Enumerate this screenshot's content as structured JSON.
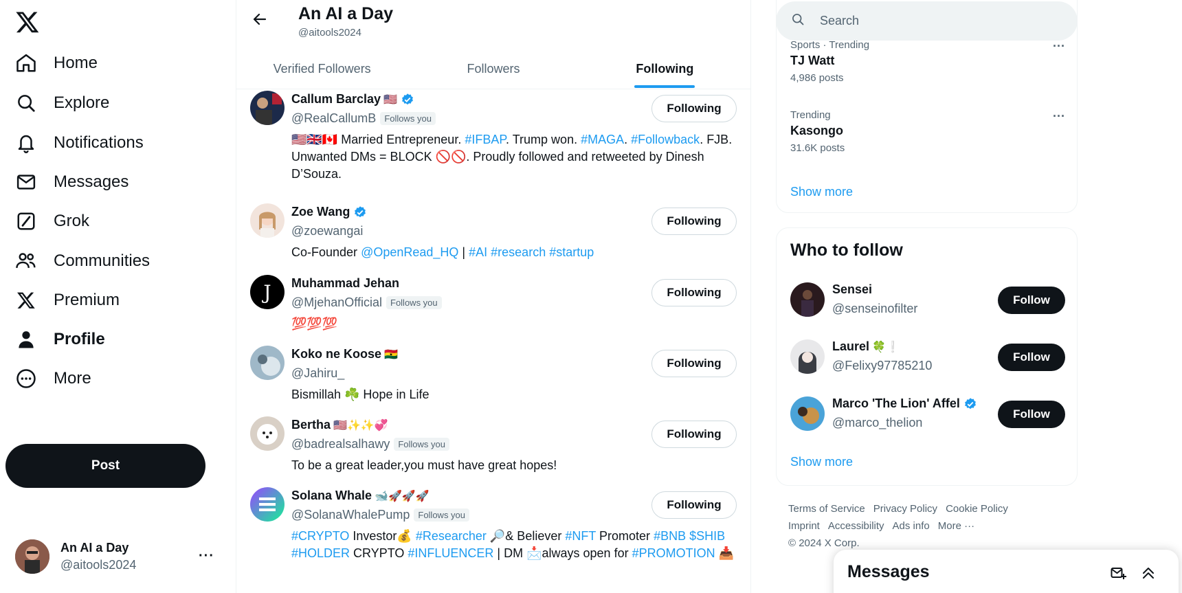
{
  "left_nav": {
    "items": [
      {
        "label": "Home",
        "icon": "home-icon"
      },
      {
        "label": "Explore",
        "icon": "search-icon"
      },
      {
        "label": "Notifications",
        "icon": "bell-icon"
      },
      {
        "label": "Messages",
        "icon": "envelope-icon"
      },
      {
        "label": "Grok",
        "icon": "grok-icon"
      },
      {
        "label": "Communities",
        "icon": "people-icon"
      },
      {
        "label": "Premium",
        "icon": "x-logo-icon"
      },
      {
        "label": "Profile",
        "icon": "person-icon"
      },
      {
        "label": "More",
        "icon": "more-circle-icon"
      }
    ],
    "post_label": "Post",
    "account": {
      "name": "An AI a Day",
      "handle": "@aitools2024",
      "menu": "···"
    }
  },
  "header": {
    "title": "An AI a Day",
    "handle": "@aitools2024",
    "tabs": [
      "Verified Followers",
      "Followers",
      "Following"
    ],
    "active_tab": "Following"
  },
  "users": [
    {
      "name": "Callum Barclay",
      "emoji": "🇺🇸",
      "verified": true,
      "handle": "@RealCallumB",
      "follows_you": "Follows you",
      "bio": "🇺🇸🇬🇧🇨🇦 Married Entrepreneur. #IFBAP. Trump won. #MAGA. #Followback. FJB. Unwanted DMs = BLOCK 🚫🚫. Proudly followed and retweeted by Dinesh D’Souza.",
      "button": "Following"
    },
    {
      "name": "Zoe Wang",
      "emoji": "",
      "verified": true,
      "handle": "@zoewangai",
      "follows_you": "",
      "bio": "Co-Founder @OpenRead_HQ | #AI #research #startup",
      "button": "Following"
    },
    {
      "name": "Muhammad Jehan",
      "emoji": "",
      "verified": false,
      "handle": "@MjehanOfficial",
      "follows_you": "Follows you",
      "bio": "💯💯💯",
      "button": "Following"
    },
    {
      "name": "Koko ne Koose",
      "emoji": "🇬🇭",
      "verified": false,
      "handle": "@Jahiru_",
      "follows_you": "",
      "bio": "Bismillah ☘️ Hope in Life",
      "button": "Following"
    },
    {
      "name": "Bertha",
      "emoji": "🇺🇸✨✨💞",
      "verified": false,
      "handle": "@badrealsalhawy",
      "follows_you": "Follows you",
      "bio": "To be a great leader,you must have great hopes!",
      "button": "Following"
    },
    {
      "name": "Solana Whale",
      "emoji": "🐋🚀🚀🚀",
      "verified": false,
      "handle": "@SolanaWhalePump",
      "follows_you": "Follows you",
      "bio": "#CRYPTO Investor💰 #Researcher 🔎& Believer #NFT Promoter #BNB $SHIB #HOLDER CRYPTO #INFLUENCER | DM 📩always open for #PROMOTION 📥",
      "button": "Following"
    }
  ],
  "search": {
    "placeholder": "Search"
  },
  "trends": [
    {
      "context": "Sports · Trending",
      "topic": "TJ Watt",
      "count": "4,986 posts"
    },
    {
      "context": "Trending",
      "topic": "Kasongo",
      "count": "31.6K posts"
    }
  ],
  "trends_show_more": "Show more",
  "who_to_follow": {
    "title": "Who to follow",
    "suggestions": [
      {
        "name": "Sensei",
        "emoji": "",
        "verified": false,
        "handle": "@senseinofilter",
        "button": "Follow"
      },
      {
        "name": "Laurel",
        "emoji": "🍀❕",
        "verified": false,
        "handle": "@Felixy97785210",
        "button": "Follow"
      },
      {
        "name": "Marco 'The Lion' Affel",
        "emoji": "",
        "verified": true,
        "handle": "@marco_thelion",
        "button": "Follow"
      }
    ],
    "show_more": "Show more"
  },
  "footer": {
    "links": [
      "Terms of Service",
      "Privacy Policy",
      "Cookie Policy",
      "Imprint",
      "Accessibility",
      "Ads info",
      "More ···"
    ],
    "copyright": "© 2024 X Corp."
  },
  "messages_drawer": {
    "title": "Messages"
  },
  "colors": {
    "accent": "#1d9bf0",
    "text": "#0f1419",
    "muted": "#536471",
    "border": "#eff3f4"
  }
}
